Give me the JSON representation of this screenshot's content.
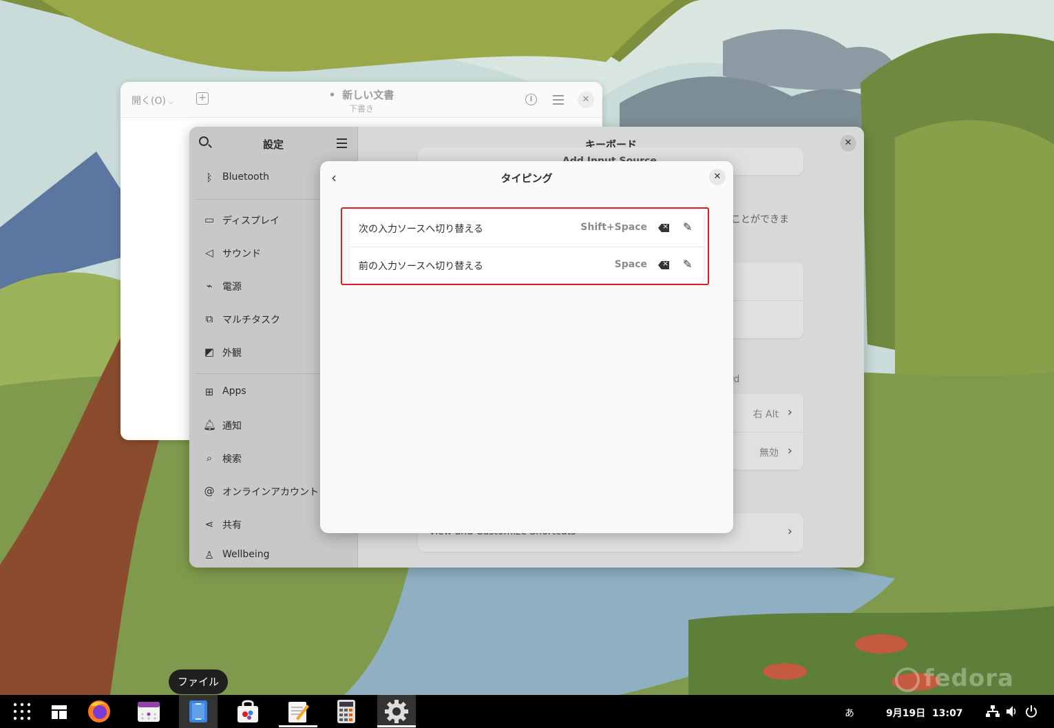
{
  "editor": {
    "open_label": "開く(O)",
    "title": "新しい文書",
    "subtitle": "下書き"
  },
  "settings": {
    "sidebar_title": "設定",
    "sidebar_items": [
      {
        "label": "Bluetooth",
        "icon": "bluetooth-icon"
      },
      {
        "label": "ディスプレイ",
        "icon": "display-icon"
      },
      {
        "label": "サウンド",
        "icon": "speaker-icon"
      },
      {
        "label": "電源",
        "icon": "power-plug-icon"
      },
      {
        "label": "マルチタスク",
        "icon": "multitask-icon"
      },
      {
        "label": "外観",
        "icon": "appearance-icon"
      },
      {
        "label": "Apps",
        "icon": "apps-grid-icon"
      },
      {
        "label": "通知",
        "icon": "bell-icon"
      },
      {
        "label": "検索",
        "icon": "search-icon"
      },
      {
        "label": "オンラインアカウント",
        "icon": "at-sign-icon"
      },
      {
        "label": "共有",
        "icon": "share-icon"
      },
      {
        "label": "Wellbeing",
        "icon": "wellbeing-icon"
      }
    ],
    "main_title": "キーボード",
    "partial_add_source": "Add Input Source",
    "partial_text": "ことができま",
    "partial_rd": "rd",
    "right_alt_value": "右 Alt",
    "disabled_value": "無効",
    "shortcuts_label": "View and Customize Shortcuts"
  },
  "dialog": {
    "title": "タイピング",
    "rows": [
      {
        "label": "次の入力ソースへ切り替える",
        "accel": "Shift+Space"
      },
      {
        "label": "前の入力ソースへ切り替える",
        "accel": "Space"
      }
    ]
  },
  "tooltip": "ファイル",
  "taskbar": {
    "input_method": "あ",
    "date": "9月19日",
    "time": "13:07",
    "apps": [
      "app-grid-icon",
      "workspace-icon",
      "firefox-icon",
      "calendar-icon",
      "files-icon",
      "software-icon",
      "text-editor-icon",
      "calculator-icon",
      "settings-icon"
    ]
  },
  "brand": "fedora",
  "colors": {
    "highlight": "#e01b24",
    "taskbar": "#000000"
  }
}
